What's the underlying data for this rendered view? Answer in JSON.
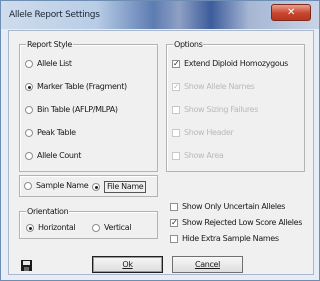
{
  "window": {
    "title": "Allele Report Settings",
    "close_glyph": "✕"
  },
  "report_style": {
    "label": "Report Style",
    "options": [
      {
        "label": "Allele List",
        "selected": false
      },
      {
        "label": "Marker Table (Fragment)",
        "selected": true
      },
      {
        "label": "Bin Table (AFLP/MLPA)",
        "selected": false
      },
      {
        "label": "Peak Table",
        "selected": false
      },
      {
        "label": "Allele Count",
        "selected": false
      }
    ]
  },
  "options": {
    "label": "Options",
    "items": [
      {
        "label": "Extend Diploid Homozygous",
        "checked": true,
        "enabled": true
      },
      {
        "label": "Show Allele Names",
        "checked": true,
        "enabled": false
      },
      {
        "label": "Show Sizing Failures",
        "checked": false,
        "enabled": false
      },
      {
        "label": "Show Header",
        "checked": false,
        "enabled": false
      },
      {
        "label": "Show Area",
        "checked": false,
        "enabled": false
      }
    ]
  },
  "sample_choice": {
    "sample_name": "Sample Name",
    "file_name": "File Name",
    "selected": "file_name"
  },
  "orientation": {
    "label": "Orientation",
    "horizontal": "Horizontal",
    "vertical": "Vertical",
    "selected": "horizontal"
  },
  "extra_checks": [
    {
      "label": "Show Only Uncertain Alleles",
      "checked": false
    },
    {
      "label": "Show Rejected Low Score Alleles",
      "checked": true
    },
    {
      "label": "Hide Extra Sample Names",
      "checked": false
    }
  ],
  "buttons": {
    "ok": "Ok",
    "cancel": "Cancel"
  },
  "icons": {
    "save": "floppy-disk-icon"
  }
}
